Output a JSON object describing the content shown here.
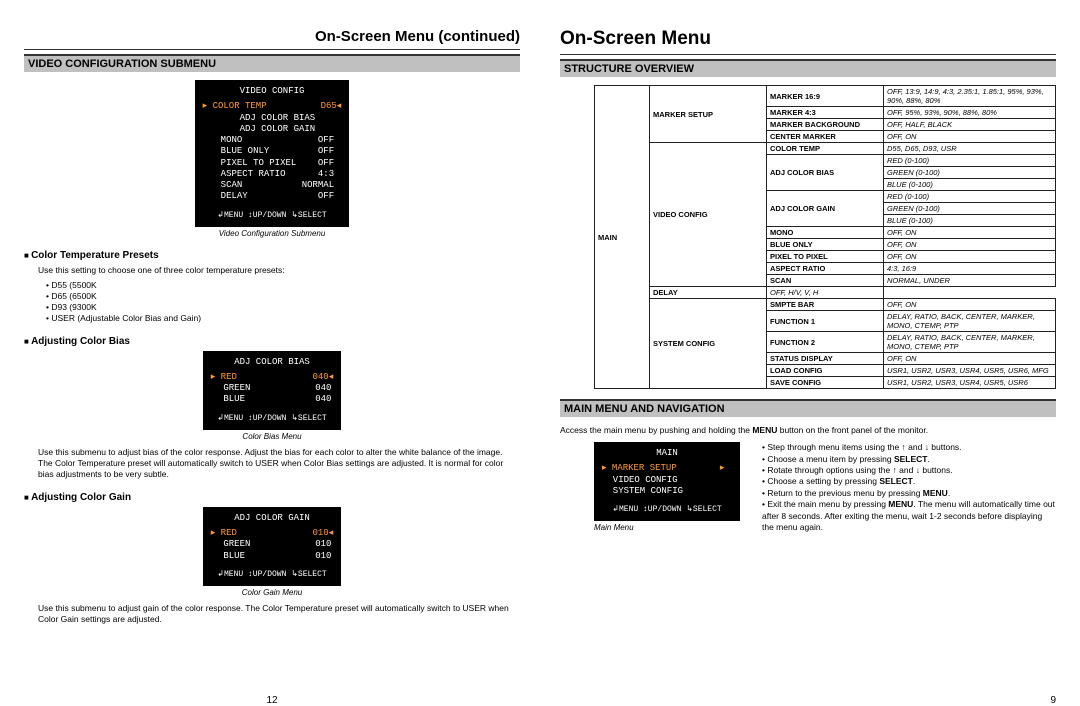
{
  "left": {
    "header": "On-Screen Menu (continued)",
    "section_bar": "VIDEO CONFIGURATION SUBMENU",
    "osd1": {
      "title": "VIDEO CONFIG",
      "lines": [
        "▸ COLOR TEMP          D65◂",
        "  ADJ COLOR BIAS",
        "  ADJ COLOR GAIN",
        "  MONO              OFF",
        "  BLUE ONLY         OFF",
        "  PIXEL TO PIXEL    OFF",
        "  ASPECT RATIO      4:3",
        "  SCAN           NORMAL",
        "  DELAY             OFF"
      ],
      "footer": "↲MENU ↕UP/DOWN ↳SELECT",
      "caption": "Video Configuration Submenu"
    },
    "sub1": {
      "heading": "Color Temperature Presets",
      "text": "Use this setting to choose one of three color temperature presets:",
      "bullets": [
        "D55 (5500K",
        "D65 (6500K",
        "D93 (9300K",
        "USER (Adjustable Color Bias and Gain)"
      ]
    },
    "sub2": {
      "heading": "Adjusting Color Bias",
      "osd": {
        "title": "ADJ COLOR BIAS",
        "lines": [
          "▸ RED              040◂",
          "  GREEN            040",
          "  BLUE             040"
        ],
        "footer": "↲MENU ↕UP/DOWN ↳SELECT",
        "caption": "Color Bias Menu"
      },
      "text": "Use this submenu to adjust bias of the color response. Adjust the bias for each color to alter the white balance of the image. The Color Temperature preset will automatically switch to USER when Color Bias settings are adjusted. It is normal for color bias adjustments to be very subtle."
    },
    "sub3": {
      "heading": "Adjusting Color Gain",
      "osd": {
        "title": "ADJ COLOR GAIN",
        "lines": [
          "▸ RED              010◂",
          "  GREEN            010",
          "  BLUE             010"
        ],
        "footer": "↲MENU ↕UP/DOWN ↳SELECT",
        "caption": "Color Gain Menu"
      },
      "text": "Use this submenu to adjust gain of the color response. The Color Temperature preset will automatically switch to USER when Color Gain settings are adjusted."
    },
    "page": "12"
  },
  "right": {
    "header": "On-Screen Menu",
    "section_bar1": "STRUCTURE OVERVIEW",
    "table": [
      {
        "c1": "MARKER SETUP",
        "c2": "MARKER 16:9",
        "c3": "OFF, 13:9, 14:9, 4:3, 2.35:1, 1.85:1, 95%, 93%, 90%, 88%, 80%",
        "c1span": 4
      },
      {
        "c2": "MARKER 4:3",
        "c3": "OFF, 95%, 93%, 90%, 88%, 80%"
      },
      {
        "c2": "MARKER BACKGROUND",
        "c3": "OFF, HALF, BLACK"
      },
      {
        "c2": "CENTER MARKER",
        "c3": "OFF, ON"
      },
      {
        "c1": "VIDEO CONFIG",
        "c2": "COLOR TEMP",
        "c3": "D55, D65, D93, USR",
        "c1span": 12
      },
      {
        "c2": "ADJ COLOR BIAS",
        "c3": "RED (0-100)",
        "c2span": 3
      },
      {
        "c3": "GREEN (0-100)"
      },
      {
        "c3": "BLUE (0-100)"
      },
      {
        "c2": "ADJ COLOR GAIN",
        "c3": "RED (0-100)",
        "c2span": 3
      },
      {
        "c3": "GREEN (0-100)"
      },
      {
        "c3": "BLUE (0-100)"
      },
      {
        "c2": "MONO",
        "c3": "OFF, ON"
      },
      {
        "c2": "BLUE ONLY",
        "c3": "OFF, ON"
      },
      {
        "c2": "PIXEL TO PIXEL",
        "c3": "OFF, ON"
      },
      {
        "c2": "ASPECT RATIO",
        "c3": "4:3, 16:9"
      },
      {
        "c2": "SCAN",
        "c3": "NORMAL, UNDER"
      },
      {
        "c2": "DELAY",
        "c3": "OFF, H/V, V, H"
      },
      {
        "c1": "SYSTEM CONFIG",
        "c2": "SMPTE BAR",
        "c3": "OFF, ON",
        "c1span": 6
      },
      {
        "c2": "FUNCTION 1",
        "c3": "DELAY, RATIO, BACK, CENTER, MARKER, MONO, CTEMP, PTP"
      },
      {
        "c2": "FUNCTION 2",
        "c3": "DELAY, RATIO, BACK, CENTER, MARKER, MONO, CTEMP, PTP"
      },
      {
        "c2": "STATUS DISPLAY",
        "c3": "OFF, ON"
      },
      {
        "c2": "LOAD CONFIG",
        "c3": "USR1, USR2, USR3, USR4, USR5, USR6, MFG"
      },
      {
        "c2": "SAVE CONFIG",
        "c3": "USR1, USR2, USR3, USR4, USR5, USR6"
      }
    ],
    "main_col_label": "MAIN",
    "section_bar2": "MAIN MENU AND NAVIGATION",
    "nav_intro_pre": "Access the main menu by pushing and holding the ",
    "nav_intro_bold": "MENU",
    "nav_intro_post": " button on the front panel of the monitor.",
    "osd_main": {
      "title": "MAIN",
      "lines": [
        "▸ MARKER SETUP        ▸",
        "  VIDEO CONFIG",
        "  SYSTEM CONFIG"
      ],
      "footer": "↲MENU ↕UP/DOWN ↳SELECT",
      "caption": "Main Menu"
    },
    "nav_bullets": [
      "Step through menu items using the ↑ and ↓ buttons.",
      "Choose a menu item by pressing <b>SELECT</b>.",
      "Rotate through options using the ↑ and ↓ buttons.",
      "Choose a setting by pressing <b>SELECT</b>.",
      "Return to the previous menu by pressing <b>MENU</b>.",
      "Exit the main menu by pressing <b>MENU</b>. The menu will automatically time out after 8 seconds. After exiting the menu, wait 1-2 seconds before displaying the menu again."
    ],
    "page": "9"
  }
}
